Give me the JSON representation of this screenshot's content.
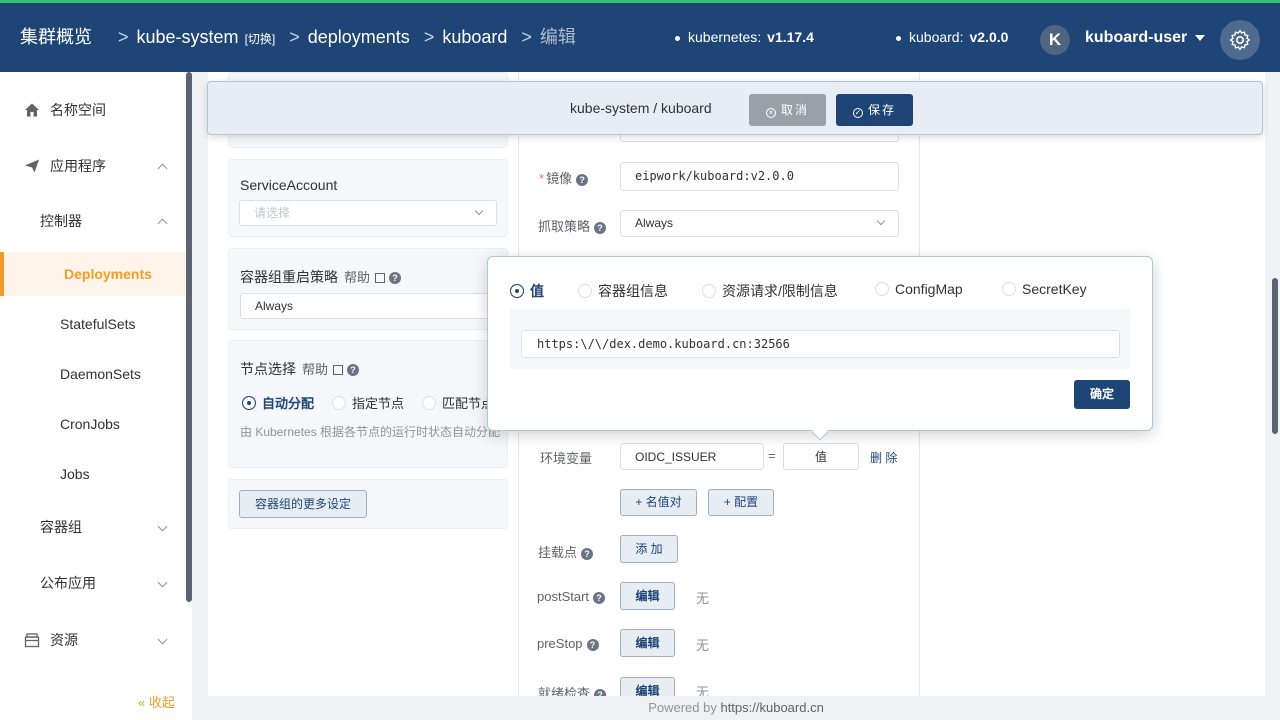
{
  "header": {
    "breadcrumb": {
      "cluster": "集群概览",
      "namespace": "kube-system",
      "switch": "[切换]",
      "sep": ">",
      "type": "deployments",
      "name": "kuboard",
      "action": "编辑"
    },
    "kubernetes_label": "kubernetes:",
    "kubernetes_version": "v1.17.4",
    "kuboard_label": "kuboard:",
    "kuboard_version": "v2.0.0",
    "avatar_letter": "K",
    "username": "kuboard-user"
  },
  "sidebar": {
    "namespace": "名称空间",
    "apps": "应用程序",
    "controllers": "控制器",
    "deployments": "Deployments",
    "statefulsets": "StatefulSets",
    "daemonsets": "DaemonSets",
    "cronjobs": "CronJobs",
    "jobs": "Jobs",
    "pods": "容器组",
    "publish": "公布应用",
    "resources": "资源",
    "collapse": "收起"
  },
  "toolbar": {
    "path": "kube-system / kuboard",
    "cancel": "取消",
    "save": "保存"
  },
  "left": {
    "service_account_title": "ServiceAccount",
    "service_account_placeholder": "请选择",
    "restart_title": "容器组重启策略",
    "help": "帮助",
    "restart_value": "Always",
    "node_title": "节点选择",
    "node_auto": "自动分配",
    "node_specified": "指定节点",
    "node_match": "匹配节点",
    "node_hint": "由 Kubernetes 根据各节点的运行时状态自动分配",
    "more_settings": "容器组的更多设定"
  },
  "middle": {
    "image_label": "镜像",
    "image_value": "eipwork/kuboard:v2.0.0",
    "pull_label": "抓取策略",
    "pull_value": "Always",
    "env_label": "环境变量",
    "env_name": "OIDC_ISSUER",
    "env_eq": "=",
    "env_value": "值",
    "env_delete": "删 除",
    "add_pair": "+ 名值对",
    "add_config": "+ 配置",
    "mount_label": "挂载点",
    "mount_add": "添 加",
    "poststart_label": "postStart",
    "prestop_label": "preStop",
    "readiness_label": "就绪检查",
    "edit": "编辑",
    "none": "无"
  },
  "popover": {
    "opt_value": "值",
    "opt_pod": "容器组信息",
    "opt_resource": "资源请求/限制信息",
    "opt_configmap": "ConfigMap",
    "opt_secret": "SecretKey",
    "input_value": "https:\\/\\/dex.demo.kuboard.cn:32566",
    "confirm": "确定"
  },
  "footer": {
    "powered": "Powered by",
    "link": "https://kuboard.cn"
  },
  "colors": {
    "primary": "#1e4575",
    "accent": "#f39c29",
    "success_bar": "#39bf72"
  }
}
